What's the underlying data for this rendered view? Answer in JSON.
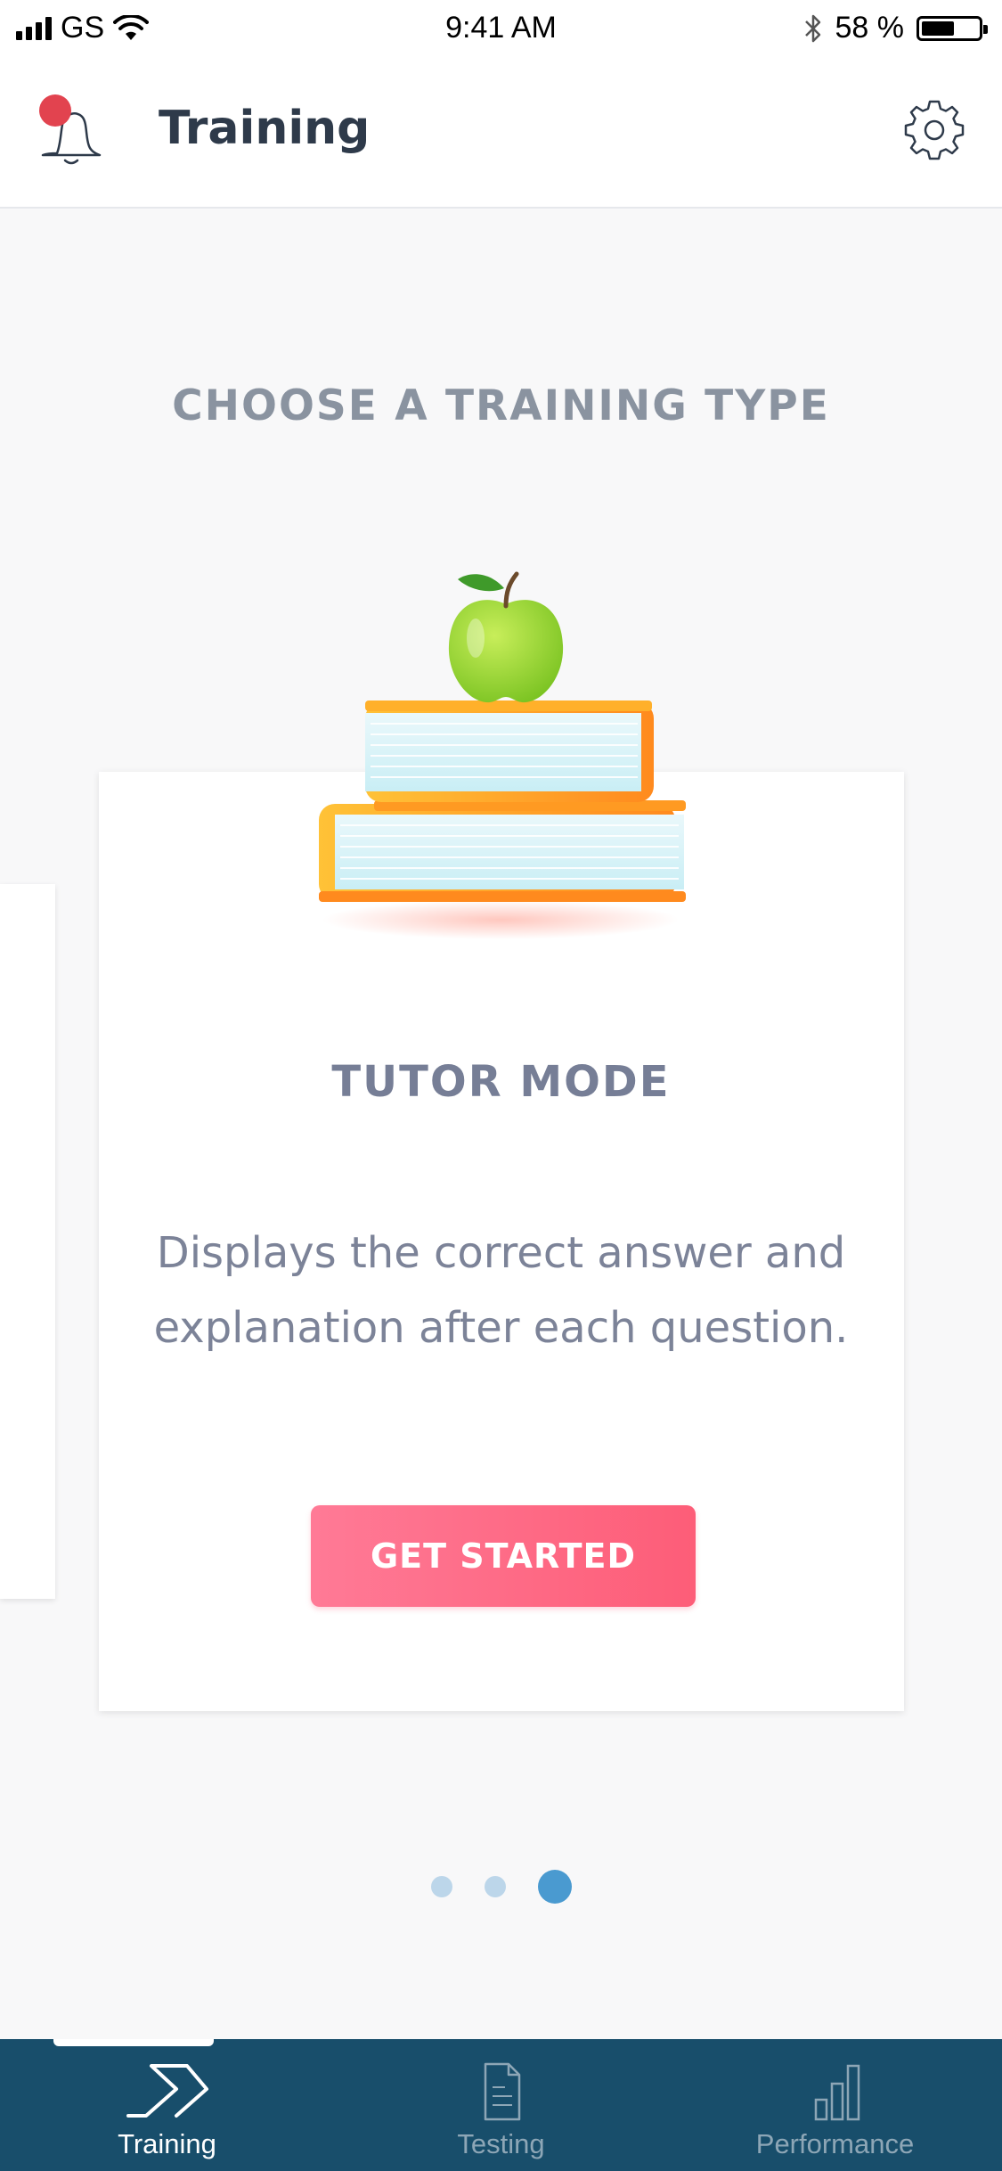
{
  "status_bar": {
    "carrier": "GS",
    "time": "9:41 AM",
    "battery_text": "58 %",
    "battery_level": 0.58
  },
  "header": {
    "title": "Training",
    "notification_icon": "bell-icon",
    "settings_icon": "gear-icon",
    "notification_dot_color": "#e2434f"
  },
  "main": {
    "section_title": "CHOOSE A TRAINING TYPE",
    "card": {
      "illustration": "books-apple-illustration",
      "title": "TUTOR MODE",
      "description": "Displays the correct answer and explanation after each question.",
      "cta_label": "GET STARTED",
      "cta_color": "#fd6a84"
    },
    "pager": {
      "total": 3,
      "current": 3
    }
  },
  "tab_bar": {
    "background": "#184e6b",
    "tabs": [
      {
        "label": "Training",
        "icon": "chevron-icon",
        "active": true
      },
      {
        "label": "Testing",
        "icon": "document-icon",
        "active": false
      },
      {
        "label": "Performance",
        "icon": "bar-chart-icon",
        "active": false
      }
    ]
  }
}
